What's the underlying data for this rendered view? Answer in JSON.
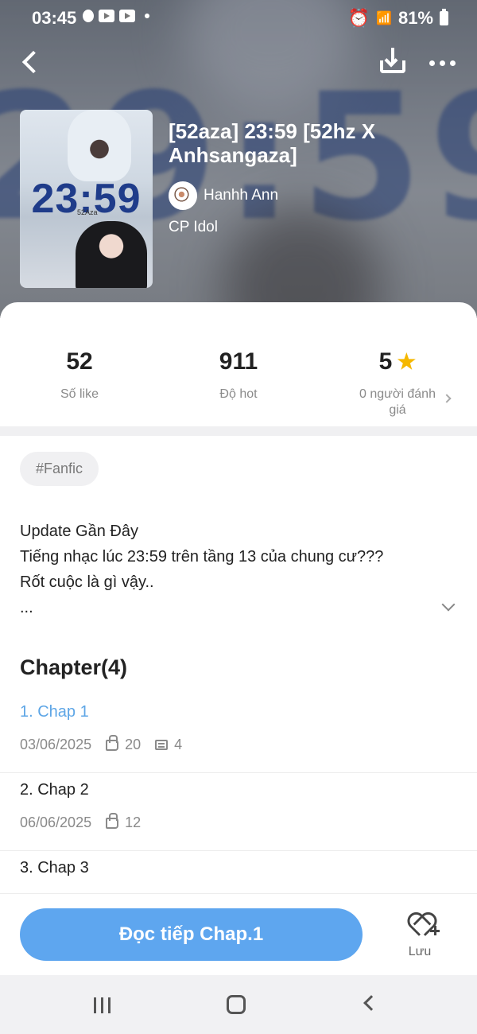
{
  "status_bar": {
    "time": "03:45",
    "battery": "81%"
  },
  "story": {
    "cover_text": "23:59",
    "cover_subtext": "52Aza",
    "title": "[52aza] 23:59 [52hz X Anhsangaza]",
    "author": "Hanhh Ann",
    "category": "CP Idol"
  },
  "stats": [
    {
      "value": "52",
      "label": "Số like"
    },
    {
      "value": "911",
      "label": "Độ hot"
    },
    {
      "value": "5",
      "label": "0 người đánh giá"
    }
  ],
  "tag": "#Fanfic",
  "description": {
    "line1": "Update Gần Đây",
    "line2": "Tiếng nhạc lúc 23:59 trên tầng 13 của chung cư???",
    "line3": "Rốt cuộc là gì vậy..",
    "line4": "..."
  },
  "chapter_heading": "Chapter(4)",
  "chapters": [
    {
      "title": "1. Chap 1",
      "date": "03/06/2025",
      "likes": "20",
      "comments": "4"
    },
    {
      "title": "2. Chap 2",
      "date": "06/06/2025",
      "likes": "12"
    },
    {
      "title": "3. Chap 3"
    }
  ],
  "bottom_bar": {
    "read_label": "Đọc tiếp Chap.1",
    "save_label": "Lưu"
  },
  "colors": {
    "accent": "#5ea6ef",
    "active_chapter": "#5ea6e6",
    "star": "#f5b800"
  }
}
